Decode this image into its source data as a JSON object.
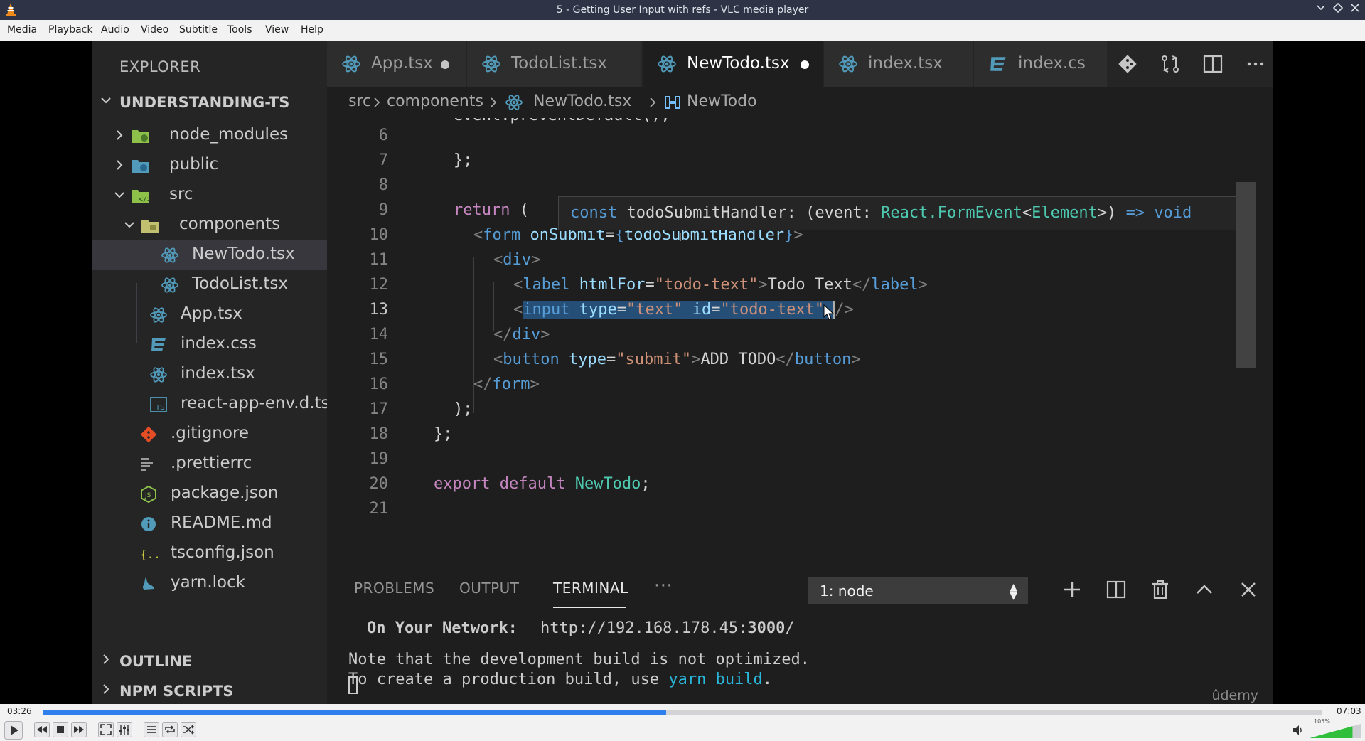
{
  "window": {
    "title": "5 - Getting User Input with refs - VLC media player"
  },
  "menu": [
    "Media",
    "Playback",
    "Audio",
    "Video",
    "Subtitle",
    "Tools",
    "View",
    "Help"
  ],
  "sidebar": {
    "title": "EXPLORER",
    "project": "UNDERSTANDING-TS",
    "items": [
      {
        "label": "node_modules",
        "icon": "folder-node-icon"
      },
      {
        "label": "public",
        "icon": "folder-public-icon"
      },
      {
        "label": "src",
        "icon": "folder-src-icon"
      },
      {
        "label": "components",
        "icon": "folder-components-icon"
      },
      {
        "label": "NewTodo.tsx",
        "icon": "react-icon"
      },
      {
        "label": "TodoList.tsx",
        "icon": "react-icon"
      },
      {
        "label": "App.tsx",
        "icon": "react-icon"
      },
      {
        "label": "index.css",
        "icon": "css-icon"
      },
      {
        "label": "index.tsx",
        "icon": "react-icon"
      },
      {
        "label": "react-app-env.d.ts",
        "icon": "typescript-icon"
      },
      {
        "label": ".gitignore",
        "icon": "git-icon"
      },
      {
        "label": ".prettierrc",
        "icon": "prettier-icon"
      },
      {
        "label": "package.json",
        "icon": "nodejs-icon"
      },
      {
        "label": "README.md",
        "icon": "info-icon"
      },
      {
        "label": "tsconfig.json",
        "icon": "json-icon"
      },
      {
        "label": "yarn.lock",
        "icon": "yarn-icon"
      }
    ],
    "outline": "OUTLINE",
    "npm_scripts": "NPM SCRIPTS"
  },
  "tabs": [
    {
      "label": "App.tsx",
      "dirty": true
    },
    {
      "label": "TodoList.tsx",
      "dirty": false
    },
    {
      "label": "NewTodo.tsx",
      "dirty": true
    },
    {
      "label": "index.tsx",
      "dirty": false
    },
    {
      "label": "index.cs",
      "dirty": false
    }
  ],
  "breadcrumb": [
    "src",
    "components",
    "NewTodo.tsx",
    "NewTodo"
  ],
  "editor": {
    "line_numbers": [
      "6",
      "7",
      "8",
      "9",
      "10",
      "11",
      "12",
      "13",
      "14",
      "15",
      "16",
      "17",
      "18",
      "19",
      "20",
      "21"
    ],
    "current_line": "13",
    "top_partial_line": "event.preventDefault();",
    "hover_tooltip": {
      "kw": "const",
      "name": "todoSubmitHandler:",
      "open": "(",
      "param": "event:",
      "ns": "React.",
      "type": "FormEvent",
      "lt": "<",
      "gen": "Element",
      "close": ">)",
      "arrow": "=>",
      "ret": "void"
    },
    "lines": {
      "l7": "};",
      "l9_kw": "return",
      "l9_paren": " (",
      "l10_tag": "form",
      "l10_attr": "onSubmit",
      "l10_val": "todoSubmitHandler",
      "l11_tag": "div",
      "l12_tag": "label",
      "l12_attr": "htmlFor",
      "l12_val": "\"todo-text\"",
      "l12_text": "Todo Text",
      "l13_tag": "input",
      "l13_attr1": "type",
      "l13_val1": "\"text\"",
      "l13_attr2": "id",
      "l13_val2": "\"todo-text\"",
      "l14_tag": "div",
      "l15_tag": "button",
      "l15_attr": "type",
      "l15_val": "\"submit\"",
      "l15_text": "ADD TODO",
      "l16_tag": "form",
      "l17": ");",
      "l18": "};",
      "l20_kw1": "export",
      "l20_kw2": "default",
      "l20_name": "NewTodo",
      "l20_end": ";"
    }
  },
  "panel": {
    "tabs": [
      "PROBLEMS",
      "OUTPUT",
      "TERMINAL"
    ],
    "more": "···",
    "terminal_select": "1: node",
    "terminal": {
      "network_label": "On Your Network:",
      "network_url_prefix": "http://192.168.178.45:",
      "network_port": "3000",
      "network_url_suffix": "/",
      "note1": "Note that the development build is not optimized.",
      "note2_prefix": "To create a production build, use ",
      "note2_cmd": "yarn build",
      "note2_suffix": "."
    },
    "watermark": "ûdemy"
  },
  "player": {
    "elapsed": "03:26",
    "total": "07:03",
    "progress": 0.487,
    "volume_label": "105%",
    "volume": 1.05
  },
  "colors": {
    "accent": "#2f80ed",
    "react": "#519aba",
    "folder_green": "#8dc149",
    "selection": "#264f78"
  }
}
